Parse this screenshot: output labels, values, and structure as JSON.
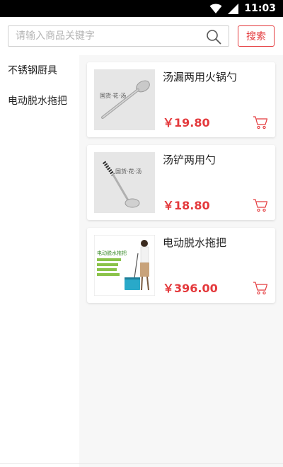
{
  "status_bar": {
    "time": "11:03",
    "icons": [
      "wifi-icon",
      "signal-icon"
    ]
  },
  "search": {
    "placeholder": "请输入商品关键字",
    "value": "",
    "button_label": "搜索",
    "icon": "search-icon"
  },
  "sidebar": {
    "items": [
      {
        "label": "不锈钢厨具"
      },
      {
        "label": "电动脱水拖把"
      }
    ]
  },
  "products": [
    {
      "title": "汤漏两用火锅勺",
      "price": "￥19.80",
      "image": "ladle-strainer-image",
      "image_label": "国货·花·汤"
    },
    {
      "title": "汤铲两用勺",
      "price": "￥18.80",
      "image": "soup-ladle-image",
      "image_label": "国货·花·汤"
    },
    {
      "title": "电动脱水拖把",
      "price": "￥396.00",
      "image": "mop-image",
      "image_label": "电动脱水拖把"
    }
  ],
  "colors": {
    "accent": "#e4393c",
    "status_bar": "#000000",
    "content_bg": "#f7f7f7"
  }
}
